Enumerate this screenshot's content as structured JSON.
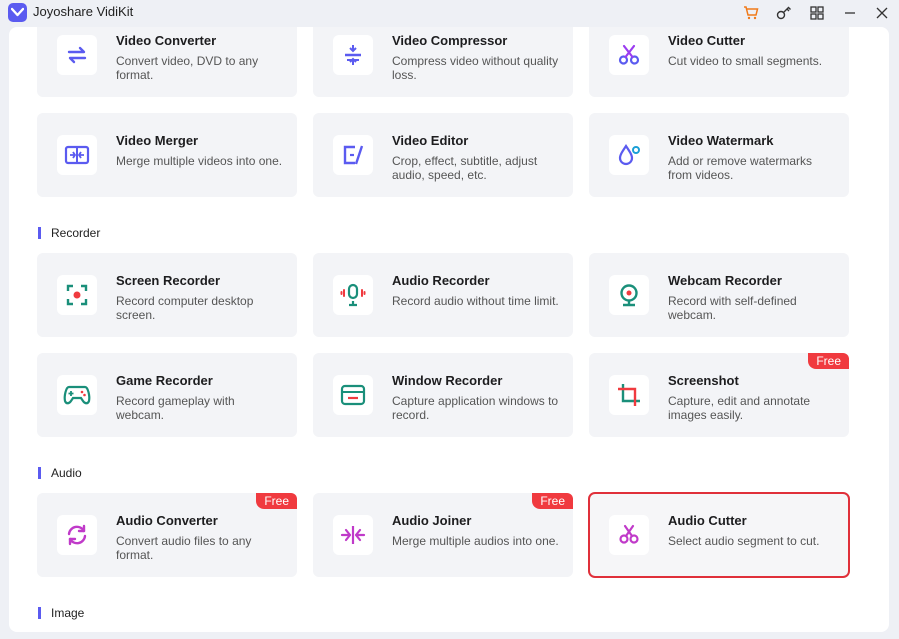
{
  "window": {
    "title": "Joyoshare VidiKit"
  },
  "sections": {
    "recorder": "Recorder",
    "audio": "Audio",
    "image": "Image"
  },
  "cards": {
    "video_converter": {
      "title": "Video Converter",
      "desc": "Convert video, DVD to any format.",
      "icon": "convert-arrows-icon"
    },
    "video_compressor": {
      "title": "Video Compressor",
      "desc": "Compress video without quality loss.",
      "icon": "compress-icon"
    },
    "video_cutter": {
      "title": "Video Cutter",
      "desc": "Cut video to small segments.",
      "icon": "scissors-icon"
    },
    "video_merger": {
      "title": "Video Merger",
      "desc": "Merge multiple videos into one.",
      "icon": "merge-icon"
    },
    "video_editor": {
      "title": "Video Editor",
      "desc": "Crop, effect, subtitle, adjust audio, speed, etc.",
      "icon": "edit-icon"
    },
    "video_watermark": {
      "title": "Video Watermark",
      "desc": "Add or remove watermarks from videos.",
      "icon": "watermark-drop-icon"
    },
    "screen_recorder": {
      "title": "Screen Recorder",
      "desc": "Record computer desktop screen.",
      "icon": "screen-record-icon"
    },
    "audio_recorder": {
      "title": "Audio Recorder",
      "desc": "Record audio without time limit.",
      "icon": "microphone-icon"
    },
    "webcam_recorder": {
      "title": "Webcam Recorder",
      "desc": "Record with self-defined webcam.",
      "icon": "webcam-icon"
    },
    "game_recorder": {
      "title": "Game Recorder",
      "desc": "Record gameplay with webcam.",
      "icon": "gamepad-icon"
    },
    "window_recorder": {
      "title": "Window Recorder",
      "desc": "Capture application windows to record.",
      "icon": "window-icon"
    },
    "screenshot": {
      "title": "Screenshot",
      "desc": "Capture, edit and annotate images easily.",
      "icon": "crop-icon",
      "badge": "Free"
    },
    "audio_converter": {
      "title": "Audio Converter",
      "desc": "Convert audio files to any format.",
      "icon": "audio-convert-icon",
      "badge": "Free"
    },
    "audio_joiner": {
      "title": "Audio Joiner",
      "desc": "Merge multiple audios into one.",
      "icon": "join-icon",
      "badge": "Free"
    },
    "audio_cutter": {
      "title": "Audio Cutter",
      "desc": "Select audio segment to cut.",
      "icon": "audio-scissors-icon"
    }
  },
  "colors": {
    "accent": "#5b5bf0",
    "teal": "#1a8f7a",
    "badge": "#f03a3f",
    "selected_border": "#e0303a"
  }
}
